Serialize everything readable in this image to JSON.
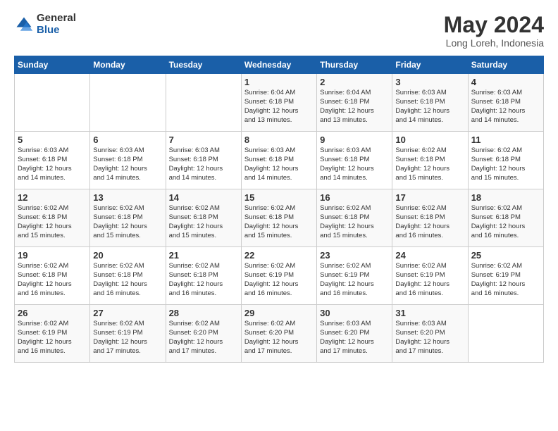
{
  "logo": {
    "general": "General",
    "blue": "Blue"
  },
  "header": {
    "title": "May 2024",
    "subtitle": "Long Loreh, Indonesia"
  },
  "days_of_week": [
    "Sunday",
    "Monday",
    "Tuesday",
    "Wednesday",
    "Thursday",
    "Friday",
    "Saturday"
  ],
  "weeks": [
    [
      {
        "day": "",
        "info": ""
      },
      {
        "day": "",
        "info": ""
      },
      {
        "day": "",
        "info": ""
      },
      {
        "day": "1",
        "info": "Sunrise: 6:04 AM\nSunset: 6:18 PM\nDaylight: 12 hours\nand 13 minutes."
      },
      {
        "day": "2",
        "info": "Sunrise: 6:04 AM\nSunset: 6:18 PM\nDaylight: 12 hours\nand 13 minutes."
      },
      {
        "day": "3",
        "info": "Sunrise: 6:03 AM\nSunset: 6:18 PM\nDaylight: 12 hours\nand 14 minutes."
      },
      {
        "day": "4",
        "info": "Sunrise: 6:03 AM\nSunset: 6:18 PM\nDaylight: 12 hours\nand 14 minutes."
      }
    ],
    [
      {
        "day": "5",
        "info": "Sunrise: 6:03 AM\nSunset: 6:18 PM\nDaylight: 12 hours\nand 14 minutes."
      },
      {
        "day": "6",
        "info": "Sunrise: 6:03 AM\nSunset: 6:18 PM\nDaylight: 12 hours\nand 14 minutes."
      },
      {
        "day": "7",
        "info": "Sunrise: 6:03 AM\nSunset: 6:18 PM\nDaylight: 12 hours\nand 14 minutes."
      },
      {
        "day": "8",
        "info": "Sunrise: 6:03 AM\nSunset: 6:18 PM\nDaylight: 12 hours\nand 14 minutes."
      },
      {
        "day": "9",
        "info": "Sunrise: 6:03 AM\nSunset: 6:18 PM\nDaylight: 12 hours\nand 14 minutes."
      },
      {
        "day": "10",
        "info": "Sunrise: 6:02 AM\nSunset: 6:18 PM\nDaylight: 12 hours\nand 15 minutes."
      },
      {
        "day": "11",
        "info": "Sunrise: 6:02 AM\nSunset: 6:18 PM\nDaylight: 12 hours\nand 15 minutes."
      }
    ],
    [
      {
        "day": "12",
        "info": "Sunrise: 6:02 AM\nSunset: 6:18 PM\nDaylight: 12 hours\nand 15 minutes."
      },
      {
        "day": "13",
        "info": "Sunrise: 6:02 AM\nSunset: 6:18 PM\nDaylight: 12 hours\nand 15 minutes."
      },
      {
        "day": "14",
        "info": "Sunrise: 6:02 AM\nSunset: 6:18 PM\nDaylight: 12 hours\nand 15 minutes."
      },
      {
        "day": "15",
        "info": "Sunrise: 6:02 AM\nSunset: 6:18 PM\nDaylight: 12 hours\nand 15 minutes."
      },
      {
        "day": "16",
        "info": "Sunrise: 6:02 AM\nSunset: 6:18 PM\nDaylight: 12 hours\nand 15 minutes."
      },
      {
        "day": "17",
        "info": "Sunrise: 6:02 AM\nSunset: 6:18 PM\nDaylight: 12 hours\nand 16 minutes."
      },
      {
        "day": "18",
        "info": "Sunrise: 6:02 AM\nSunset: 6:18 PM\nDaylight: 12 hours\nand 16 minutes."
      }
    ],
    [
      {
        "day": "19",
        "info": "Sunrise: 6:02 AM\nSunset: 6:18 PM\nDaylight: 12 hours\nand 16 minutes."
      },
      {
        "day": "20",
        "info": "Sunrise: 6:02 AM\nSunset: 6:18 PM\nDaylight: 12 hours\nand 16 minutes."
      },
      {
        "day": "21",
        "info": "Sunrise: 6:02 AM\nSunset: 6:18 PM\nDaylight: 12 hours\nand 16 minutes."
      },
      {
        "day": "22",
        "info": "Sunrise: 6:02 AM\nSunset: 6:19 PM\nDaylight: 12 hours\nand 16 minutes."
      },
      {
        "day": "23",
        "info": "Sunrise: 6:02 AM\nSunset: 6:19 PM\nDaylight: 12 hours\nand 16 minutes."
      },
      {
        "day": "24",
        "info": "Sunrise: 6:02 AM\nSunset: 6:19 PM\nDaylight: 12 hours\nand 16 minutes."
      },
      {
        "day": "25",
        "info": "Sunrise: 6:02 AM\nSunset: 6:19 PM\nDaylight: 12 hours\nand 16 minutes."
      }
    ],
    [
      {
        "day": "26",
        "info": "Sunrise: 6:02 AM\nSunset: 6:19 PM\nDaylight: 12 hours\nand 16 minutes."
      },
      {
        "day": "27",
        "info": "Sunrise: 6:02 AM\nSunset: 6:19 PM\nDaylight: 12 hours\nand 17 minutes."
      },
      {
        "day": "28",
        "info": "Sunrise: 6:02 AM\nSunset: 6:20 PM\nDaylight: 12 hours\nand 17 minutes."
      },
      {
        "day": "29",
        "info": "Sunrise: 6:02 AM\nSunset: 6:20 PM\nDaylight: 12 hours\nand 17 minutes."
      },
      {
        "day": "30",
        "info": "Sunrise: 6:03 AM\nSunset: 6:20 PM\nDaylight: 12 hours\nand 17 minutes."
      },
      {
        "day": "31",
        "info": "Sunrise: 6:03 AM\nSunset: 6:20 PM\nDaylight: 12 hours\nand 17 minutes."
      },
      {
        "day": "",
        "info": ""
      }
    ]
  ]
}
